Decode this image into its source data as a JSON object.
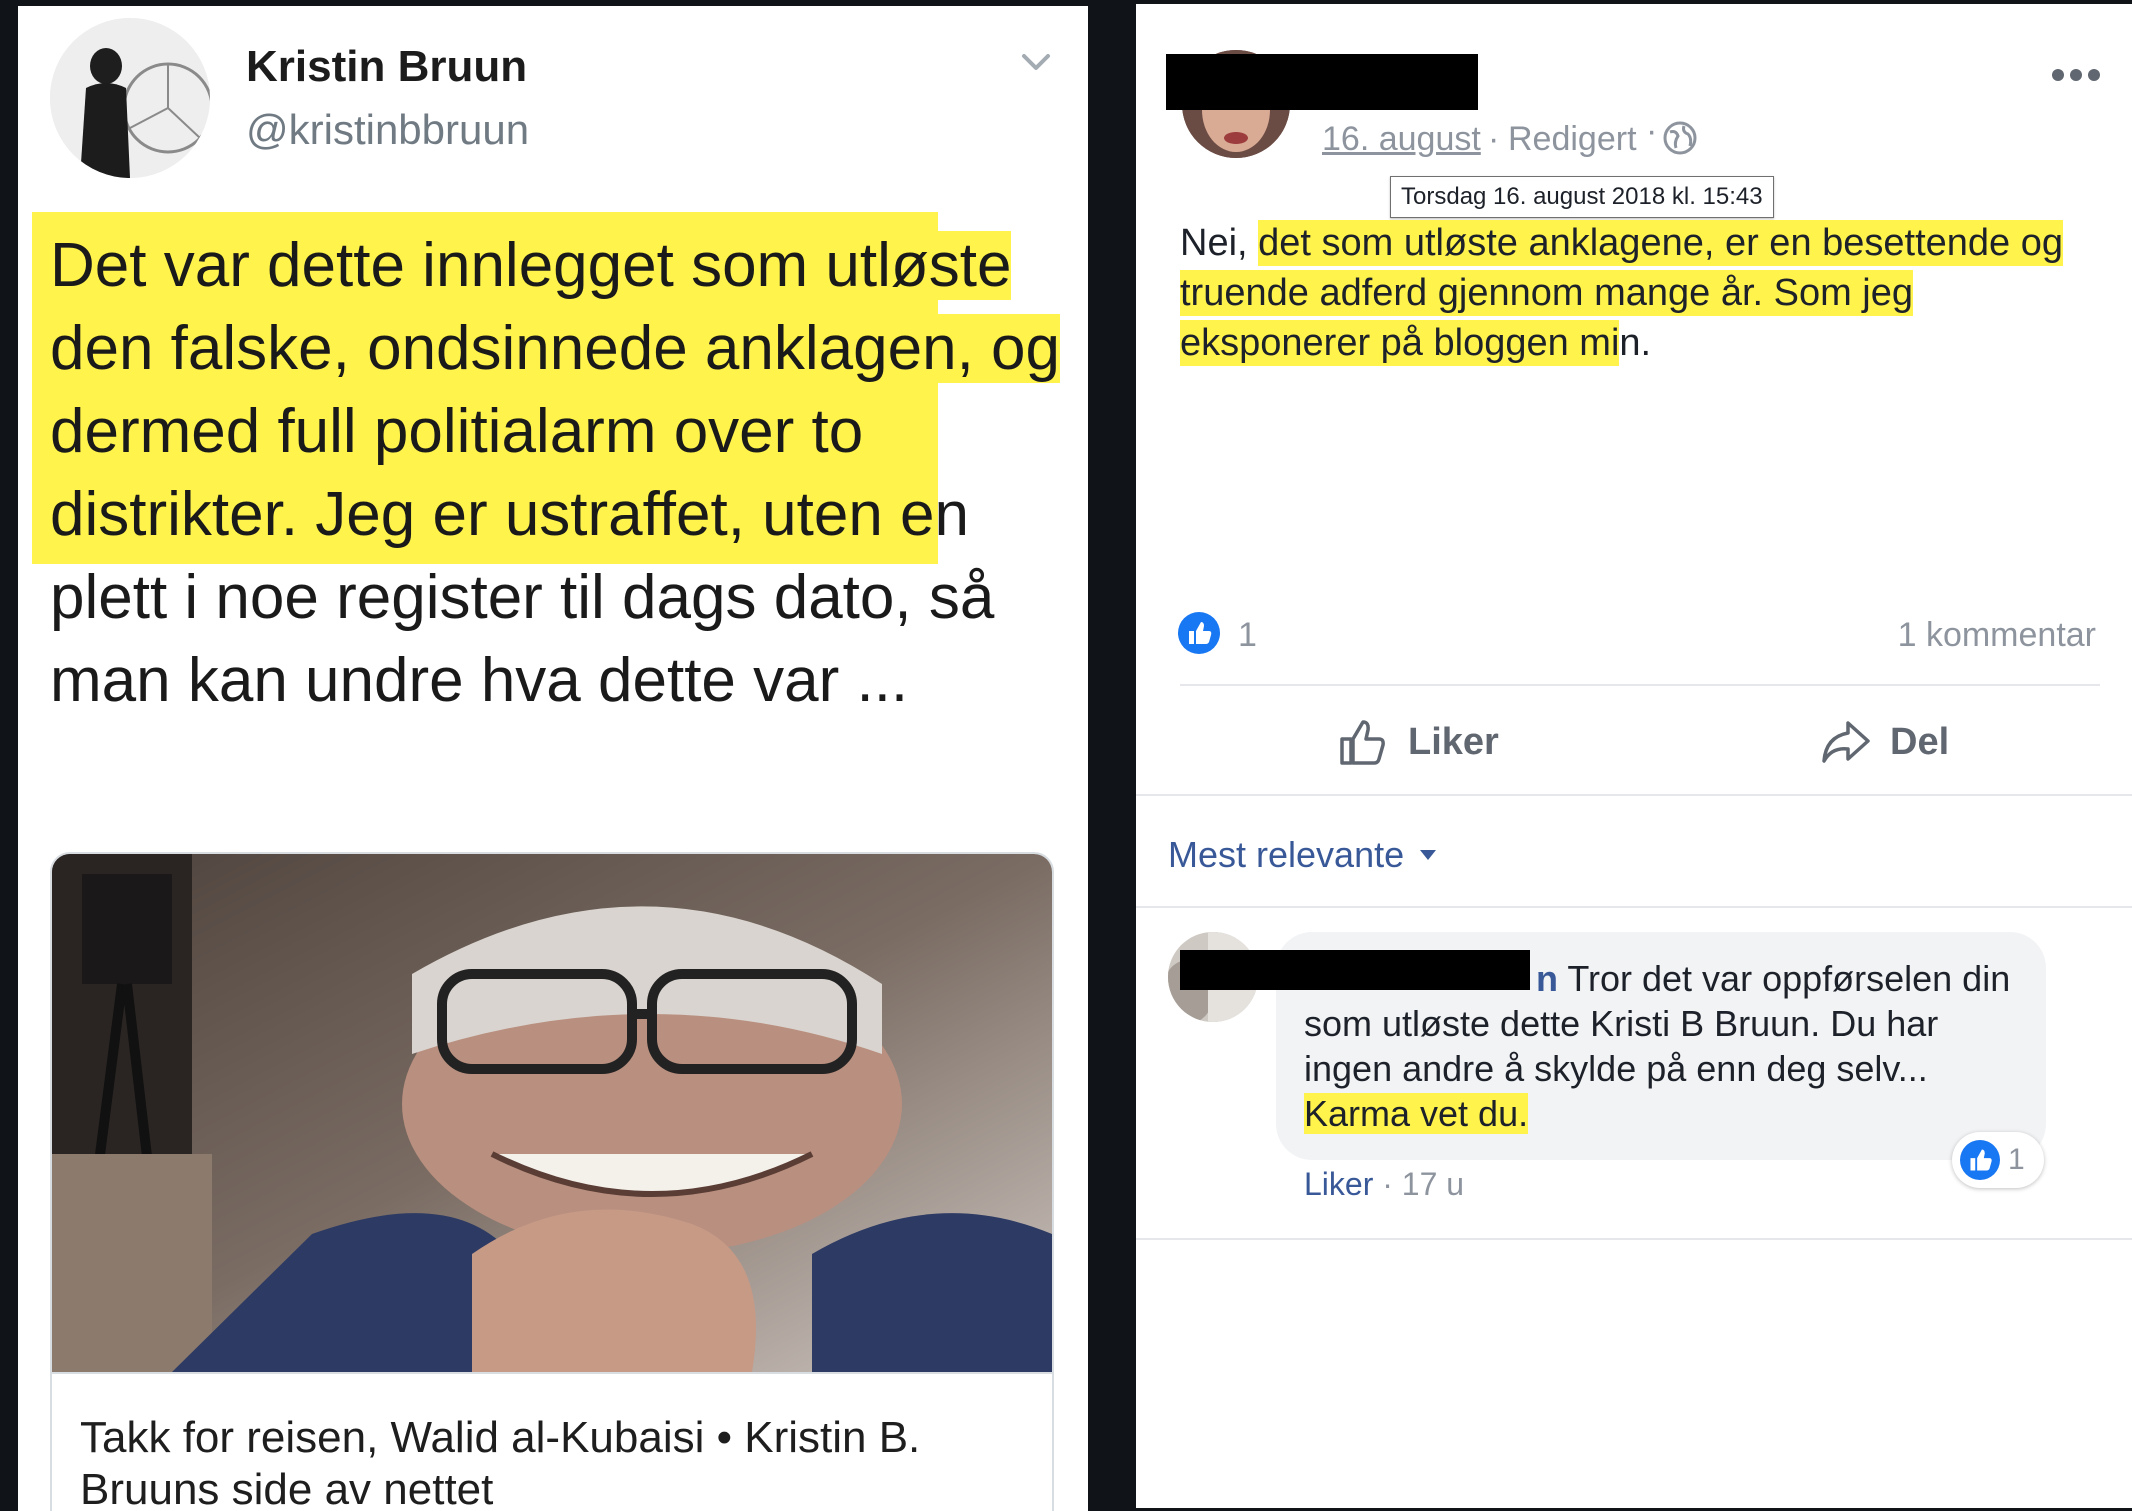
{
  "tweet": {
    "author_name": "Kristin Bruun",
    "author_handle": "@kristinbbruun",
    "icons": {
      "menu": "chevron-down-icon"
    },
    "text_highlighted": "Det var dette innlegget som utløste den falske, ondsinnede anklagen, og dermed full politialarm over to distrikter.",
    "text_rest": " Jeg er ustraffet, uten en plett i noe register til dags dato, så man kan undre hva dette var ...",
    "card": {
      "title": "Takk for reisen, Walid al-Kubaisi • Kristin B. Bruuns side av nettet"
    }
  },
  "facebook_post": {
    "date_link": "16. august",
    "meta_separator": "·",
    "edited_label": "Redigert",
    "icons": {
      "privacy": "globe-icon",
      "menu": "more-dots-icon",
      "like": "thumbs-up-icon",
      "share": "share-arrow-icon",
      "sort": "caret-down-icon"
    },
    "tooltip": "Torsdag 16. august 2018 kl. 15:43",
    "text_plain_start": "Nei, ",
    "text_highlighted": "det som utløste anklagene, er en besettende og truende adferd gjennom mange år. Som jeg eksponerer på bloggen mi",
    "text_plain_end": "n.",
    "reactions_count": "1",
    "comments_count": "1 kommentar",
    "actions": {
      "like": "Liker",
      "share": "Del"
    },
    "sort_label": "Mest relevante",
    "comment": {
      "name_tail": "n",
      "text_plain": " Tror det var oppførselen din som utløste dette Kristi B Bruun. Du har ingen andre å skylde på enn deg selv... ",
      "text_highlighted": "Karma vet du.",
      "reaction_count": "1",
      "like_label": "Liker",
      "separator": " · ",
      "time": "17 u"
    },
    "colors": {
      "link_blue": "#385898",
      "like_blue": "#1877f2",
      "highlight": "#fff34c",
      "meta_gray": "#8d949e"
    }
  }
}
